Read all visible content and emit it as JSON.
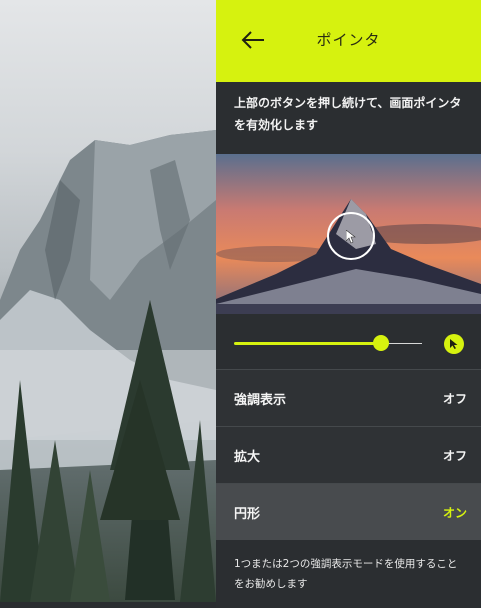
{
  "header": {
    "title": "ポインタ",
    "back_icon": "arrow-left-icon"
  },
  "description": "上部のボタンを押し続けて、画面ポインタを有効化します",
  "slider": {
    "value_fraction": 0.78,
    "cursor_icon": "cursor-icon"
  },
  "settings": [
    {
      "label": "強調表示",
      "value": "オフ"
    },
    {
      "label": "拡大",
      "value": "オフ"
    },
    {
      "label": "円形",
      "value": "オン"
    }
  ],
  "footer_note": "1つまたは2つの強調表示モードを使用することをお勧めします",
  "colors": {
    "accent": "#d6f20f",
    "panel": "#2b2e31",
    "active_row": "#484b4e"
  }
}
